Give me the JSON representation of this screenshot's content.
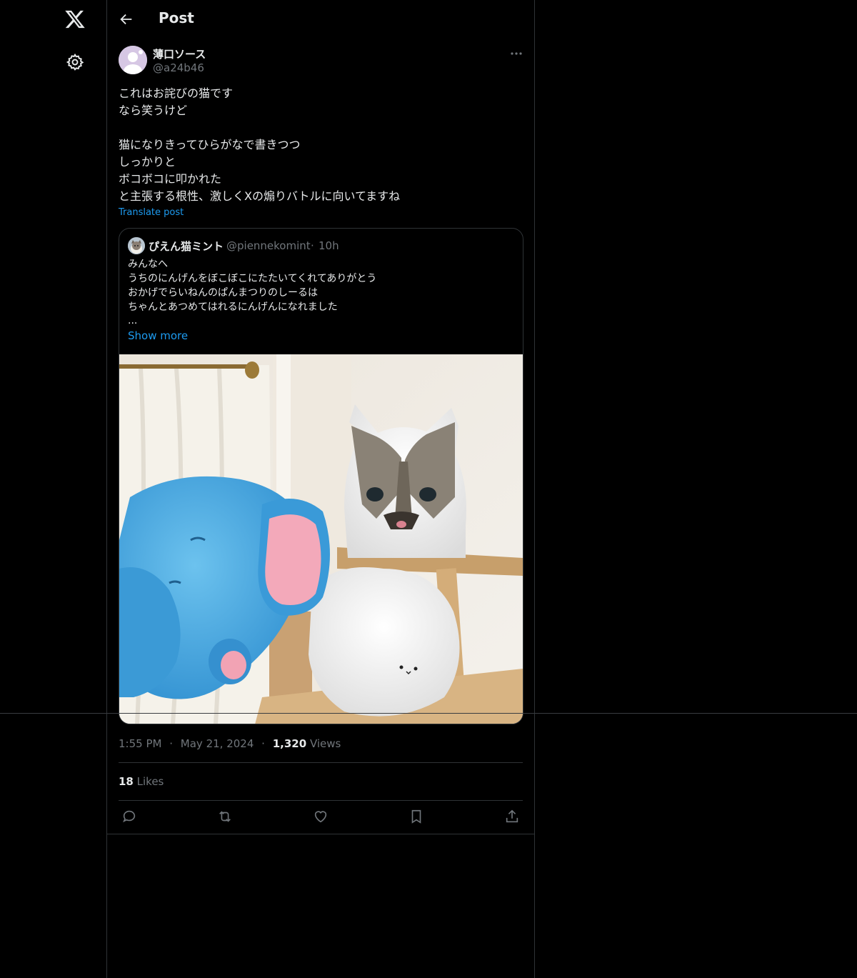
{
  "nav": {
    "logo_icon": "x-logo-icon",
    "settings_icon": "gear-icon"
  },
  "header": {
    "title": "Post",
    "back_icon": "arrow-left-icon"
  },
  "post": {
    "author": {
      "display_name": "薄口ソース",
      "handle": "@a24b46"
    },
    "text": "これはお詫びの猫です\nなら笑うけど\n\n猫になりきってひらがなで書きつつ\nしっかりと\nボコボコに叩かれた\nと主張する根性、激しくXの煽りバトルに向いてますね",
    "translate_label": "Translate post",
    "time": "1:55 PM",
    "date": "May 21, 2024",
    "views_count": "1,320",
    "views_label": "Views",
    "likes_count": "18",
    "likes_label": "Likes"
  },
  "quote": {
    "display_name": "ぴえん猫ミント",
    "handle": "@piennekomint",
    "dot": "·",
    "time": "10h",
    "text": "みんなへ\nうちのにんげんをぼこぼこにたたいてくれてありがとう\nおかげでらいねんのぱんまつりのしーるは\nちゃんとあつめてはれるにんげんになれました",
    "ellipsis": "...",
    "show_more": "Show more",
    "media_description_icon": "photo-cat-with-plush-toys"
  },
  "meta": {
    "separator": "·"
  },
  "actions": [
    "reply-icon",
    "repost-icon",
    "like-icon",
    "bookmark-icon",
    "share-icon"
  ],
  "colors": {
    "background": "#000000",
    "text": "#e7e9ea",
    "muted": "#71767b",
    "link": "#1d9bf0",
    "border": "#2f3336"
  }
}
